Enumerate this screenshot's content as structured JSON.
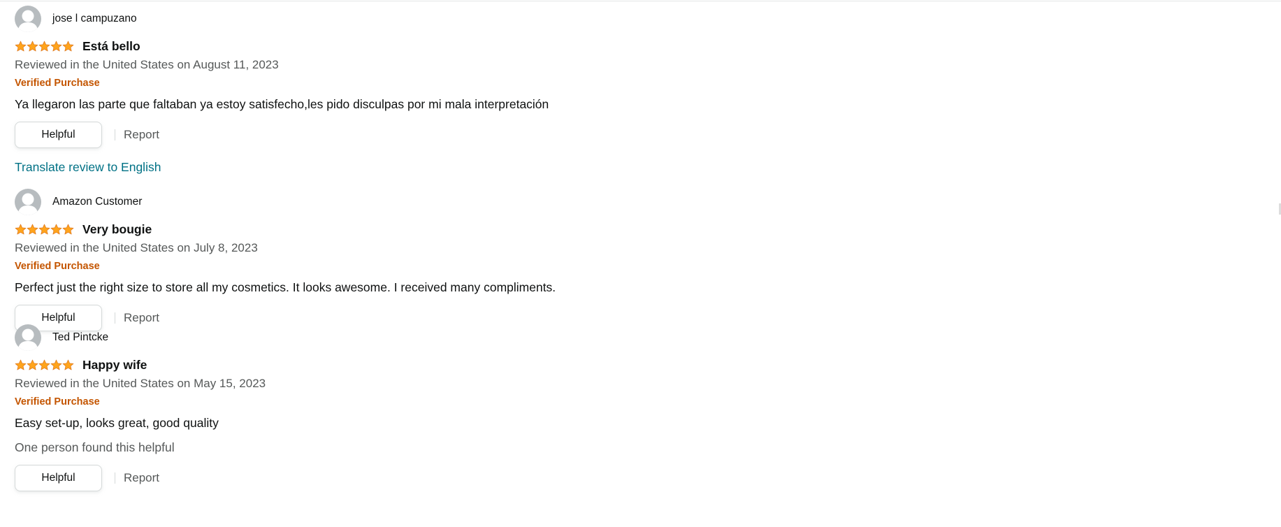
{
  "colors": {
    "star": "#ffa41c",
    "verified": "#c45500",
    "link": "#007185",
    "secondary_text": "#565959"
  },
  "icons": {
    "avatar": "default-profile-avatar-icon",
    "star": "star-icon"
  },
  "reviews": [
    {
      "profile_name": "jose l campuzano",
      "rating": 5,
      "title": "Está bello",
      "date": "Reviewed in the United States on August 11, 2023",
      "verified": "Verified Purchase",
      "body": "Ya llegaron las parte que faltaban ya estoy satisfecho,les pido disculpas por mi mala interpretación",
      "helpful_label": "Helpful",
      "report_label": "Report",
      "translate_label": "Translate review to English"
    },
    {
      "profile_name": "Amazon Customer",
      "rating": 5,
      "title": "Very bougie",
      "date": "Reviewed in the United States on July 8, 2023",
      "verified": "Verified Purchase",
      "body": "Perfect just the right size to store all my cosmetics. It looks awesome. I received many compliments.",
      "helpful_label": "Helpful",
      "report_label": "Report"
    },
    {
      "profile_name": "Ted Pintcke",
      "rating": 5,
      "title": "Happy wife",
      "date": "Reviewed in the United States on May 15, 2023",
      "verified": "Verified Purchase",
      "body": "Easy set-up, looks great, good quality",
      "helpful_count": "One person found this helpful",
      "helpful_label": "Helpful",
      "report_label": "Report"
    }
  ]
}
